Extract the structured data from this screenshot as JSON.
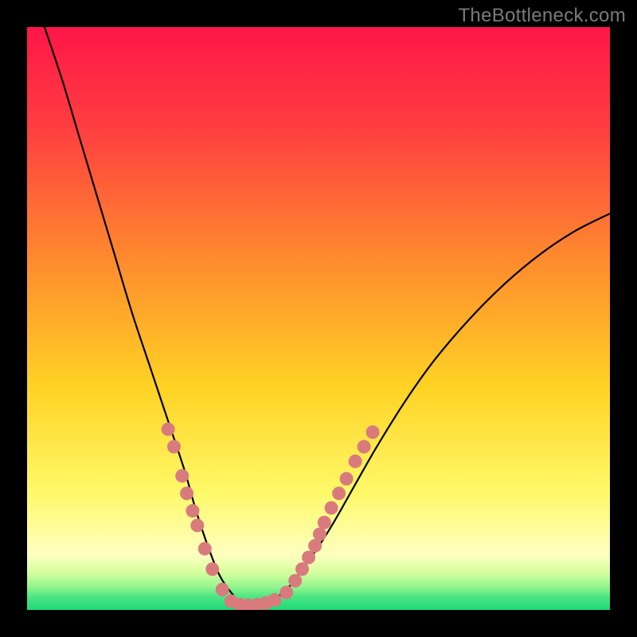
{
  "watermark": "TheBottleneck.com",
  "colors": {
    "frame": "#000000",
    "watermark": "#7a7a7a",
    "curve": "#000000",
    "markers": "#d97b7d",
    "gradient_stops": [
      {
        "offset": 0.0,
        "color": "#ff1648"
      },
      {
        "offset": 0.18,
        "color": "#ff4040"
      },
      {
        "offset": 0.4,
        "color": "#ff8b2e"
      },
      {
        "offset": 0.62,
        "color": "#ffd324"
      },
      {
        "offset": 0.8,
        "color": "#fff96a"
      },
      {
        "offset": 0.905,
        "color": "#ffffc0"
      },
      {
        "offset": 0.935,
        "color": "#d7ff9e"
      },
      {
        "offset": 0.96,
        "color": "#95f58e"
      },
      {
        "offset": 0.978,
        "color": "#4be583"
      },
      {
        "offset": 1.0,
        "color": "#1ed878"
      }
    ]
  },
  "chart_data": {
    "type": "line",
    "title": "",
    "xlabel": "",
    "ylabel": "",
    "xlim": [
      0,
      100
    ],
    "ylim": [
      0,
      100
    ],
    "series": [
      {
        "name": "bottleneck-curve",
        "x": [
          3,
          6,
          9,
          12,
          15,
          18,
          21,
          24,
          27,
          29,
          31,
          33,
          35,
          37,
          40,
          44,
          48,
          52,
          56,
          60,
          65,
          70,
          76,
          82,
          88,
          94,
          100
        ],
        "y": [
          100,
          91,
          81,
          71,
          61,
          51,
          42,
          33,
          24,
          17,
          11,
          6,
          3,
          1,
          1,
          3,
          8,
          14,
          21,
          28,
          36,
          43,
          50,
          56,
          61,
          65,
          68
        ]
      }
    ],
    "markers": {
      "name": "highlighted-points",
      "points": [
        {
          "x": 24.2,
          "y": 31.0
        },
        {
          "x": 25.2,
          "y": 28.0
        },
        {
          "x": 26.6,
          "y": 23.0
        },
        {
          "x": 27.4,
          "y": 20.0
        },
        {
          "x": 28.4,
          "y": 17.0
        },
        {
          "x": 29.2,
          "y": 14.5
        },
        {
          "x": 30.5,
          "y": 10.5
        },
        {
          "x": 31.8,
          "y": 7.0
        },
        {
          "x": 33.5,
          "y": 3.5
        },
        {
          "x": 35.0,
          "y": 1.5
        },
        {
          "x": 36.5,
          "y": 0.9
        },
        {
          "x": 38.0,
          "y": 0.8
        },
        {
          "x": 39.5,
          "y": 0.9
        },
        {
          "x": 41.0,
          "y": 1.2
        },
        {
          "x": 42.5,
          "y": 1.7
        },
        {
          "x": 44.5,
          "y": 3.0
        },
        {
          "x": 46.0,
          "y": 5.0
        },
        {
          "x": 47.2,
          "y": 7.0
        },
        {
          "x": 48.3,
          "y": 9.0
        },
        {
          "x": 49.4,
          "y": 11.0
        },
        {
          "x": 50.2,
          "y": 13.0
        },
        {
          "x": 51.0,
          "y": 15.0
        },
        {
          "x": 52.2,
          "y": 17.5
        },
        {
          "x": 53.5,
          "y": 20.0
        },
        {
          "x": 54.8,
          "y": 22.5
        },
        {
          "x": 56.3,
          "y": 25.5
        },
        {
          "x": 57.8,
          "y": 28.0
        },
        {
          "x": 59.3,
          "y": 30.5
        }
      ]
    }
  }
}
